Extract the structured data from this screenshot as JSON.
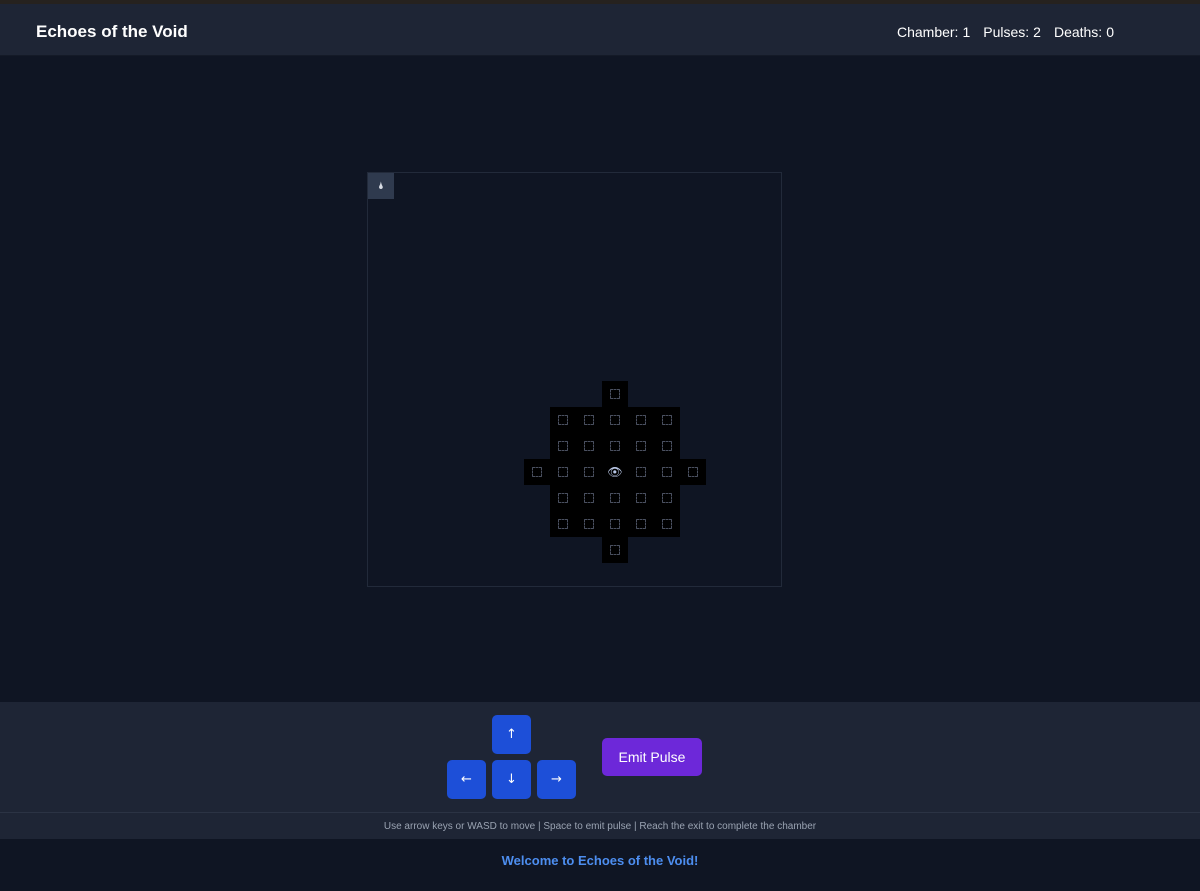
{
  "header": {
    "title": "Echoes of the Void",
    "stats": {
      "chamber_label": "Chamber:",
      "chamber_value": "1",
      "pulses_label": "Pulses:",
      "pulses_value": "2",
      "deaths_label": "Deaths: ",
      "deaths_value": "0"
    }
  },
  "board": {
    "grid_size": [
      16,
      16
    ],
    "start_cell": {
      "col": 0,
      "row": 0,
      "icon": "start-marker-icon",
      "glyph": "🌢"
    },
    "player": {
      "col": 9,
      "row": 11,
      "icon": "player-icon",
      "glyph": "👁"
    },
    "revealed_cells": [
      [
        9,
        8
      ],
      [
        7,
        9
      ],
      [
        8,
        9
      ],
      [
        9,
        9
      ],
      [
        10,
        9
      ],
      [
        11,
        9
      ],
      [
        7,
        10
      ],
      [
        8,
        10
      ],
      [
        9,
        10
      ],
      [
        10,
        10
      ],
      [
        11,
        10
      ],
      [
        6,
        11
      ],
      [
        7,
        11
      ],
      [
        8,
        11
      ],
      [
        9,
        11
      ],
      [
        10,
        11
      ],
      [
        11,
        11
      ],
      [
        12,
        11
      ],
      [
        7,
        12
      ],
      [
        8,
        12
      ],
      [
        9,
        12
      ],
      [
        10,
        12
      ],
      [
        11,
        12
      ],
      [
        7,
        13
      ],
      [
        8,
        13
      ],
      [
        9,
        13
      ],
      [
        10,
        13
      ],
      [
        11,
        13
      ],
      [
        9,
        14
      ]
    ]
  },
  "controls": {
    "up": "↑",
    "left": "←",
    "down": "↓",
    "right": "→",
    "pulse_label": "Emit Pulse",
    "button_color": "#1d4fd8",
    "pulse_color": "#6d28d9"
  },
  "hint": "Use arrow keys or WASD to move | Space to emit pulse | Reach the exit to complete the chamber",
  "message": "Welcome to Echoes of the Void!"
}
